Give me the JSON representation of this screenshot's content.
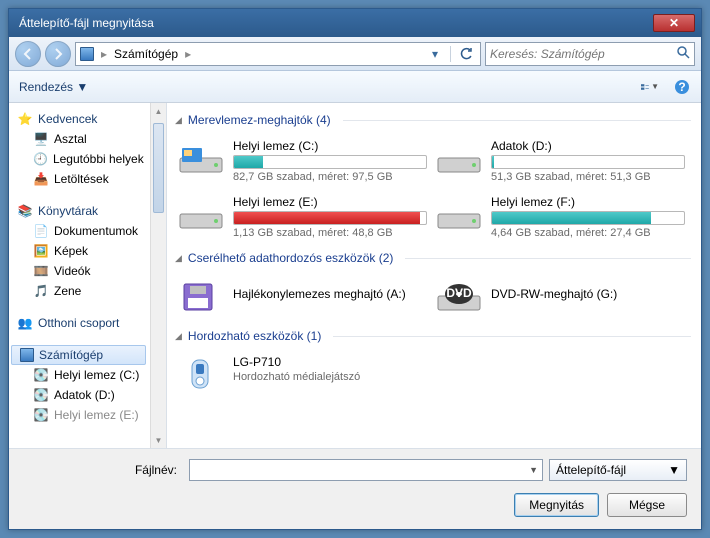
{
  "title": "Áttelepítő-fájl megnyitása",
  "breadcrumb": {
    "root": "Számítógép"
  },
  "search": {
    "placeholder": "Keresés: Számítógép"
  },
  "toolbar": {
    "organize": "Rendezés"
  },
  "sidebar": {
    "favorites": {
      "label": "Kedvencek",
      "items": [
        "Asztal",
        "Legutóbbi helyek",
        "Letöltések"
      ]
    },
    "libraries": {
      "label": "Könyvtárak",
      "items": [
        "Dokumentumok",
        "Képek",
        "Videók",
        "Zene"
      ]
    },
    "homegroup": {
      "label": "Otthoni csoport"
    },
    "computer": {
      "label": "Számítógép",
      "items": [
        "Helyi lemez (C:)",
        "Adatok (D:)",
        "Helyi lemez (E:)"
      ]
    }
  },
  "groups": {
    "hdd": {
      "label": "Merevlemez-meghajtók (4)"
    },
    "remov": {
      "label": "Cserélhető adathordozós eszközök (2)"
    },
    "port": {
      "label": "Hordozható eszközök (1)"
    }
  },
  "drives": {
    "c": {
      "name": "Helyi lemez (C:)",
      "stat": "82,7 GB szabad, méret: 97,5 GB",
      "pct": 15,
      "color": "teal"
    },
    "d": {
      "name": "Adatok (D:)",
      "stat": "51,3 GB szabad, méret: 51,3 GB",
      "pct": 1,
      "color": "teal"
    },
    "e": {
      "name": "Helyi lemez (E:)",
      "stat": "1,13 GB szabad, méret: 48,8 GB",
      "pct": 97,
      "color": "red"
    },
    "f": {
      "name": "Helyi lemez (F:)",
      "stat": "4,64 GB szabad, méret: 27,4 GB",
      "pct": 83,
      "color": "teal"
    }
  },
  "removable": {
    "floppy": {
      "name": "Hajlékonylemezes meghajtó (A:)"
    },
    "dvd": {
      "name": "DVD-RW-meghajtó (G:)"
    }
  },
  "portable": {
    "lg": {
      "name": "LG-P710",
      "sub": "Hordozható médialejátszó"
    }
  },
  "footer": {
    "filename_label": "Fájlnév:",
    "filetype": "Áttelepítő-fájl",
    "open": "Megnyitás",
    "cancel": "Mégse"
  }
}
